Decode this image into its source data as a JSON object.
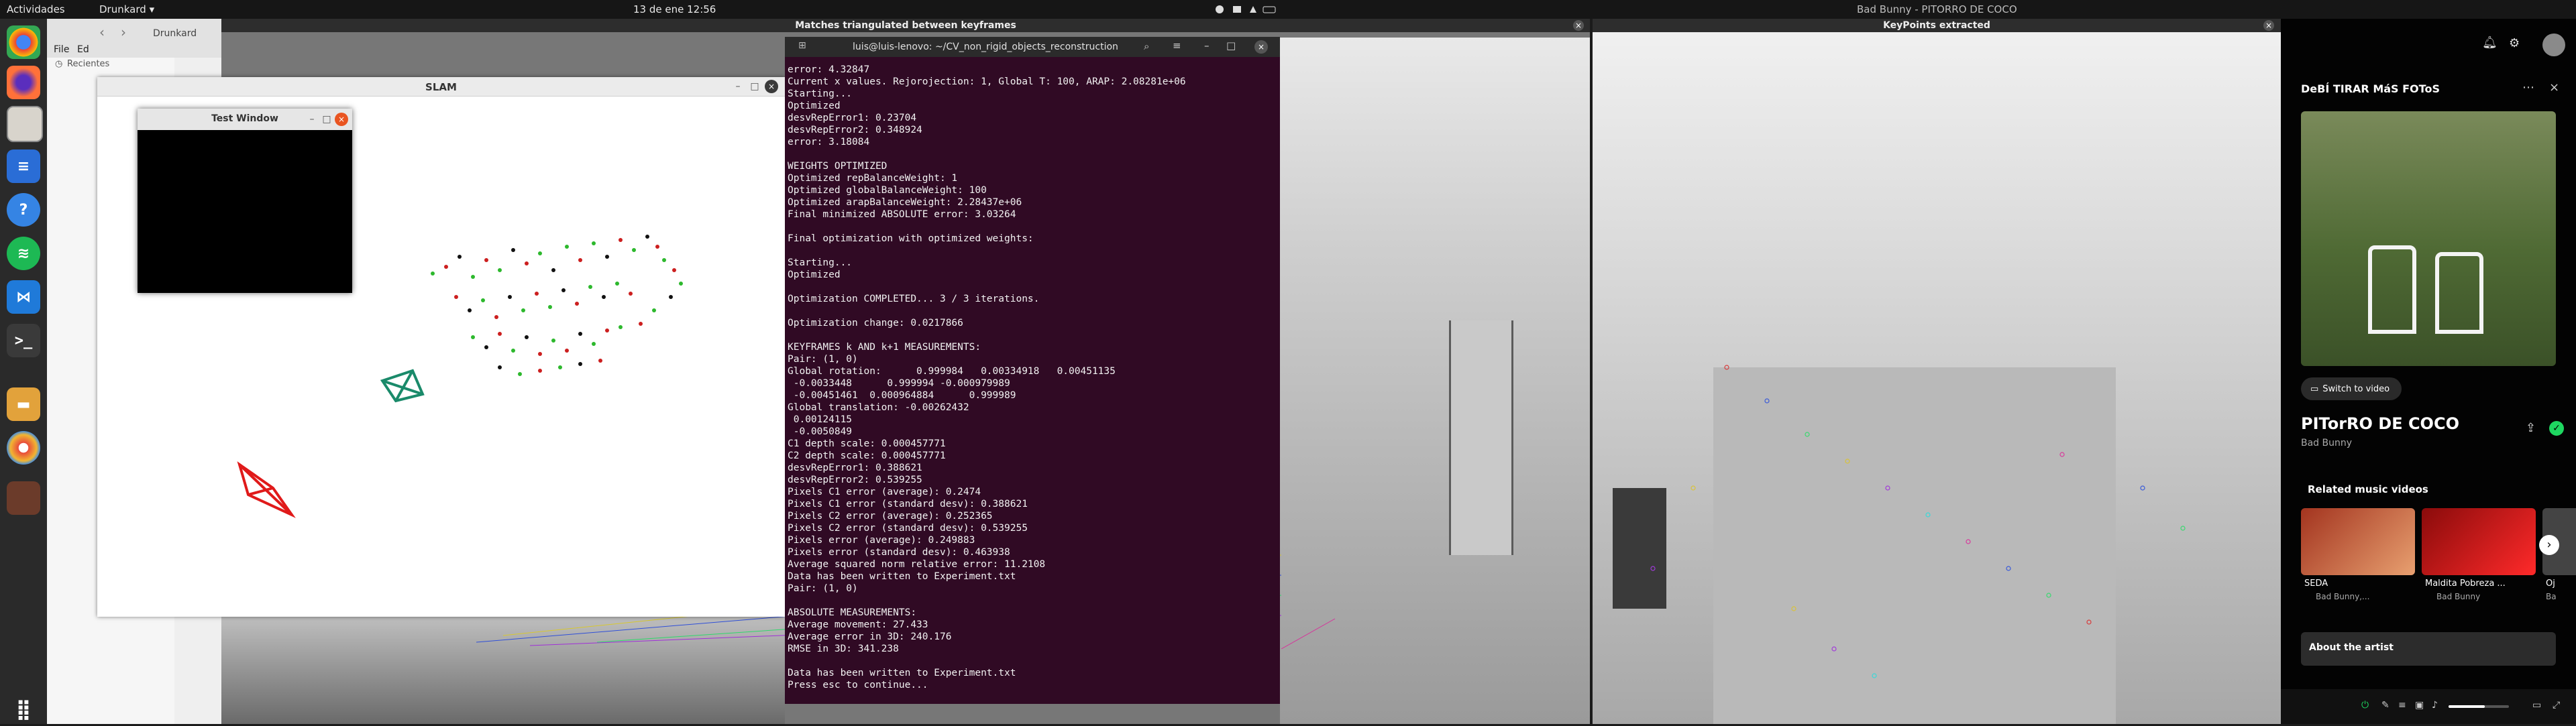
{
  "topbar": {
    "activities": "Actividades",
    "app_menu": "Drunkard",
    "app_menu_arrow": "▾",
    "clock": "13 de ene  12:56",
    "right_window_title": "Bad Bunny - PITORRO DE COCO"
  },
  "dock": {
    "apps": [
      "Chrome",
      "Firefox",
      "Files",
      "Writer",
      "Help",
      "Spotify",
      "VS Code",
      "Terminal",
      "Archive",
      "Photos",
      "Shotwell"
    ],
    "show_apps_icon": "grid-icon"
  },
  "file_manager": {
    "menu_file": "File",
    "menu_edit": "Ed",
    "nav_back": "‹",
    "nav_forward": "›",
    "path": "Drunkard",
    "sidebar_item": "Recientes"
  },
  "matches_window": {
    "title": "Matches triangulated between keyframes"
  },
  "keypoints_window": {
    "title": "KeyPoints extracted"
  },
  "slam_window": {
    "title": "SLAM",
    "minimize": "–",
    "maximize": "□",
    "close": "×"
  },
  "test_window": {
    "title": "Test Window",
    "minimize": "–",
    "maximize": "□",
    "close": "×"
  },
  "terminal": {
    "title": "luis@luis-lenovo: ~/CV_non_rigid_objects_reconstruction",
    "lines": [
      "error: 4.32847",
      "Current x values. Rejorojection: 1, Global T: 100, ARAP: 2.08281e+06",
      "Starting...",
      "Optimized",
      "desvRepError1: 0.23704",
      "desvRepError2: 0.348924",
      "error: 3.18084",
      "",
      "WEIGHTS OPTIMIZED",
      "Optimized repBalanceWeight: 1",
      "Optimized globalBalanceWeight: 100",
      "Optimized arapBalanceWeight: 2.28437e+06",
      "Final minimized ABSOLUTE error: 3.03264",
      "",
      "Final optimization with optimized weights:",
      "",
      "Starting...",
      "Optimized",
      "",
      "Optimization COMPLETED... 3 / 3 iterations.",
      "",
      "Optimization change: 0.0217866",
      "",
      "KEYFRAMES k AND k+1 MEASUREMENTS:",
      "Pair: (1, 0)",
      "Global rotation:      0.999984   0.00334918   0.00451135",
      " -0.0033448      0.999994 -0.000979989",
      " -0.00451461  0.000964884      0.999989",
      "Global translation: -0.00262432",
      " 0.00124115",
      " -0.0050849",
      "C1 depth scale: 0.000457771",
      "C2 depth scale: 0.000457771",
      "desvRepError1: 0.388621",
      "desvRepError2: 0.539255",
      "Pixels C1 error (average): 0.2474",
      "Pixels C1 error (standard desv): 0.388621",
      "Pixels C2 error (average): 0.252365",
      "Pixels C2 error (standard desv): 0.539255",
      "Pixels error (average): 0.249883",
      "Pixels error (standard desv): 0.463938",
      "Average squared norm relative error: 11.2108",
      "Data has been written to Experiment.txt",
      "Pair: (1, 0)",
      "",
      "ABSOLUTE MEASUREMENTS:",
      "Average movement: 27.433",
      "Average error in 3D: 240.176",
      "RMSE in 3D: 341.238",
      "",
      "Data has been written to Experiment.txt",
      "Press esc to continue..."
    ]
  },
  "youtube_music": {
    "channel_title": "DeBÍ TIRAR MáS FOToS",
    "switch_to_video": "Switch to video",
    "song_title": "PITorRO DE COCO",
    "artist": "Bad Bunny",
    "related_heading": "Related music videos",
    "related": [
      {
        "title": "SEDA",
        "artist": "Bad Bunny,..."
      },
      {
        "title": "Maldita Pobreza ...",
        "artist": "Bad Bunny"
      },
      {
        "title": "Oj",
        "artist": "Ba"
      }
    ],
    "about_artist": "About the artist",
    "accent_green": "#1ed760"
  },
  "colors": {
    "terminal_bg": "#300a24",
    "camera_red": "#e01a1a",
    "camera_green": "#1a8a6a",
    "point_green": "#2db82d",
    "point_red": "#cc1f1f"
  }
}
